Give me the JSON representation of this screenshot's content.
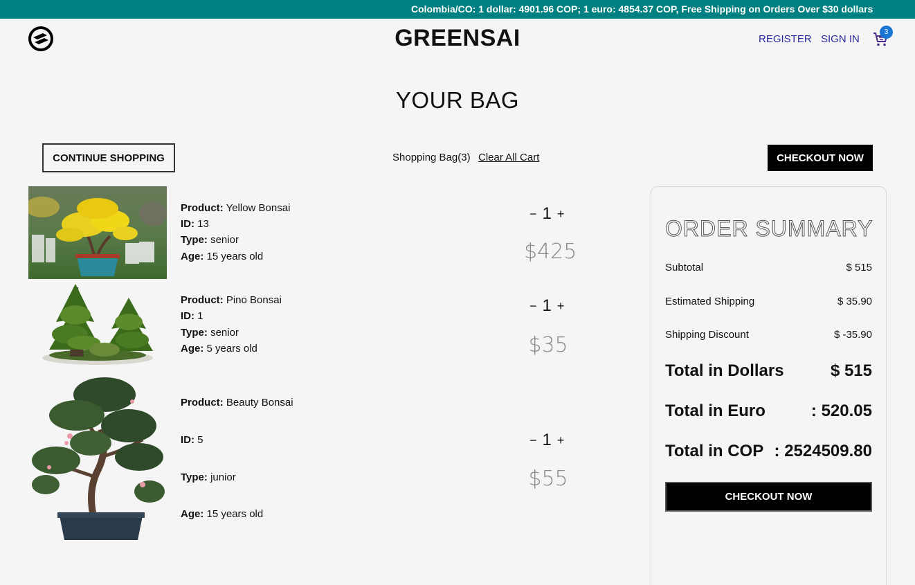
{
  "announcement": "Colombia/CO: 1 dollar: 4901.96 COP; 1 euro: 4854.37 COP, Free Shipping on Orders Over $30 dollars",
  "header": {
    "brand": "GREENSAI",
    "register": "REGISTER",
    "sign_in": "SIGN IN",
    "cart_count": "3"
  },
  "page_title": "YOUR BAG",
  "toolbar": {
    "continue_label": "CONTINUE SHOPPING",
    "bag_count": "Shopping Bag(3)",
    "clear_label": "Clear All Cart",
    "checkout_label": "CHECKOUT NOW"
  },
  "labels": {
    "product": "Product:",
    "id": "ID:",
    "type": "Type:",
    "age": "Age:"
  },
  "items": [
    {
      "name": "Yellow Bonsai",
      "id": "13",
      "type": "senior",
      "age": "15 years old",
      "quantity": "1",
      "price": "$425"
    },
    {
      "name": "Pino Bonsai",
      "id": "1",
      "type": "senior",
      "age": "5 years old",
      "quantity": "1",
      "price": "$35"
    },
    {
      "name": "Beauty Bonsai",
      "id": "5",
      "type": "junior",
      "age": "15 years old",
      "quantity": "1",
      "price": "$55"
    }
  ],
  "qty_controls": {
    "minus": "−",
    "plus": "+"
  },
  "summary": {
    "title": "ORDER SUMMARY",
    "subtotal_label": "Subtotal",
    "subtotal_value": "$ 515",
    "shipping_label": "Estimated Shipping",
    "shipping_value": "$ 35.90",
    "discount_label": "Shipping Discount",
    "discount_value": "$ -35.90",
    "total_usd_label": "Total in Dollars",
    "total_usd_value": "$ 515",
    "total_eur_label": "Total in Euro",
    "total_eur_value": ": 520.05",
    "total_cop_label": "Total in COP",
    "total_cop_value": ": 2524509.80",
    "checkout_label": "CHECKOUT NOW"
  },
  "colors": {
    "announcement_bg": "#008080",
    "nav_link": "#2a2aa0",
    "cart_badge": "#1976d2",
    "button_bg": "#000000"
  }
}
